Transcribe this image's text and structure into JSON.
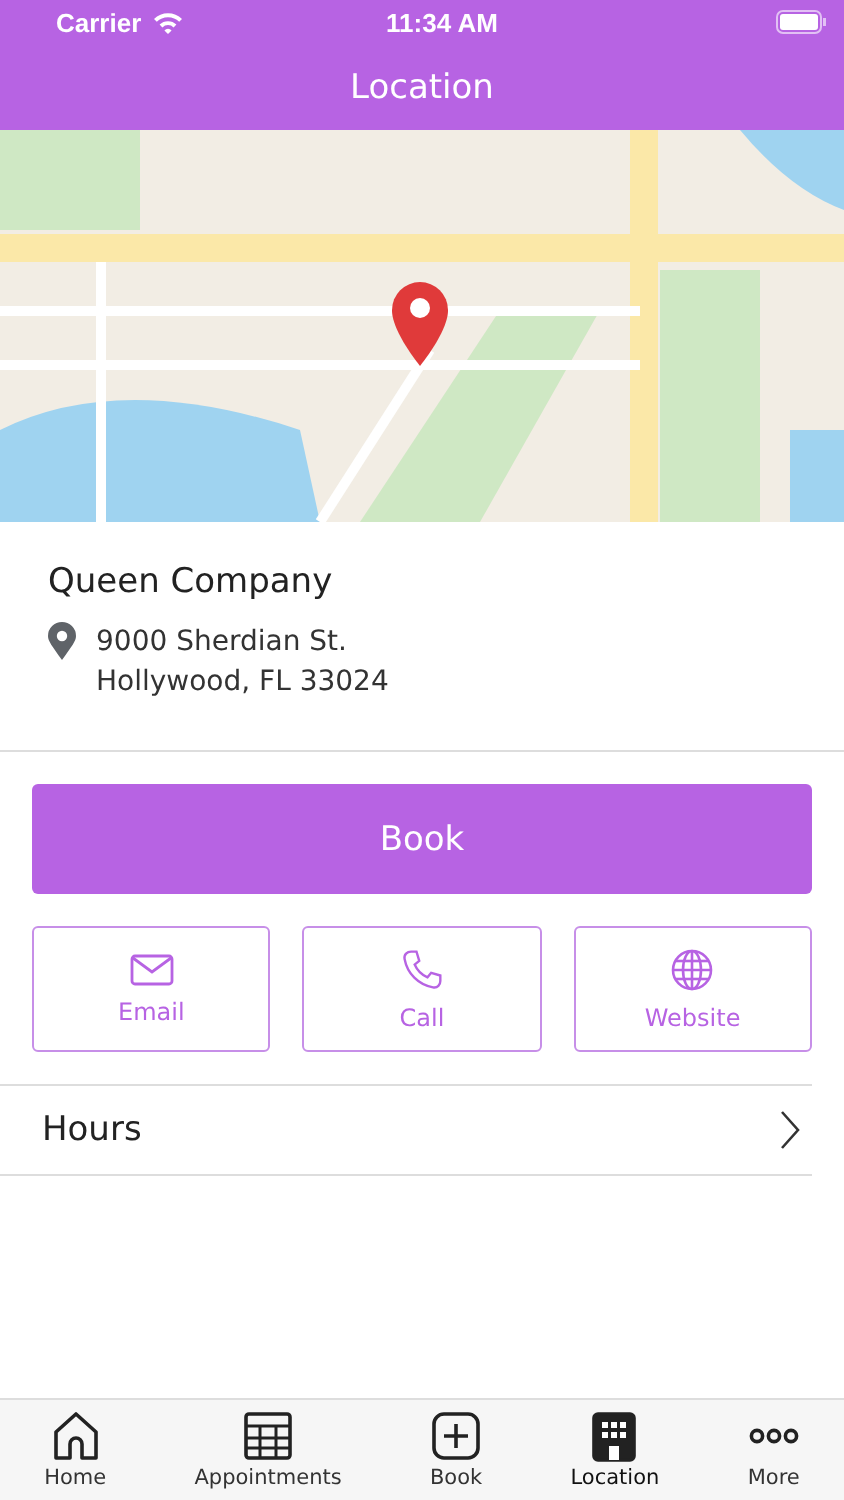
{
  "status_bar": {
    "carrier": "Carrier",
    "time": "11:34 AM"
  },
  "nav_bar": {
    "title": "Location"
  },
  "business": {
    "name": "Queen Company",
    "address_lines": [
      "9000 Sherdian St.",
      "Hollywood, FL 33024"
    ]
  },
  "primary_button": "Book",
  "actions": [
    {
      "label": "Email"
    },
    {
      "label": "Call"
    },
    {
      "label": "Website"
    }
  ],
  "hours_row": {
    "label": "Hours"
  },
  "tab_bar": [
    {
      "label": "Home",
      "selected": false
    },
    {
      "label": "Appointments",
      "selected": false
    },
    {
      "label": "Book",
      "selected": false
    },
    {
      "label": "Location",
      "selected": true
    },
    {
      "label": "More",
      "selected": false
    }
  ]
}
